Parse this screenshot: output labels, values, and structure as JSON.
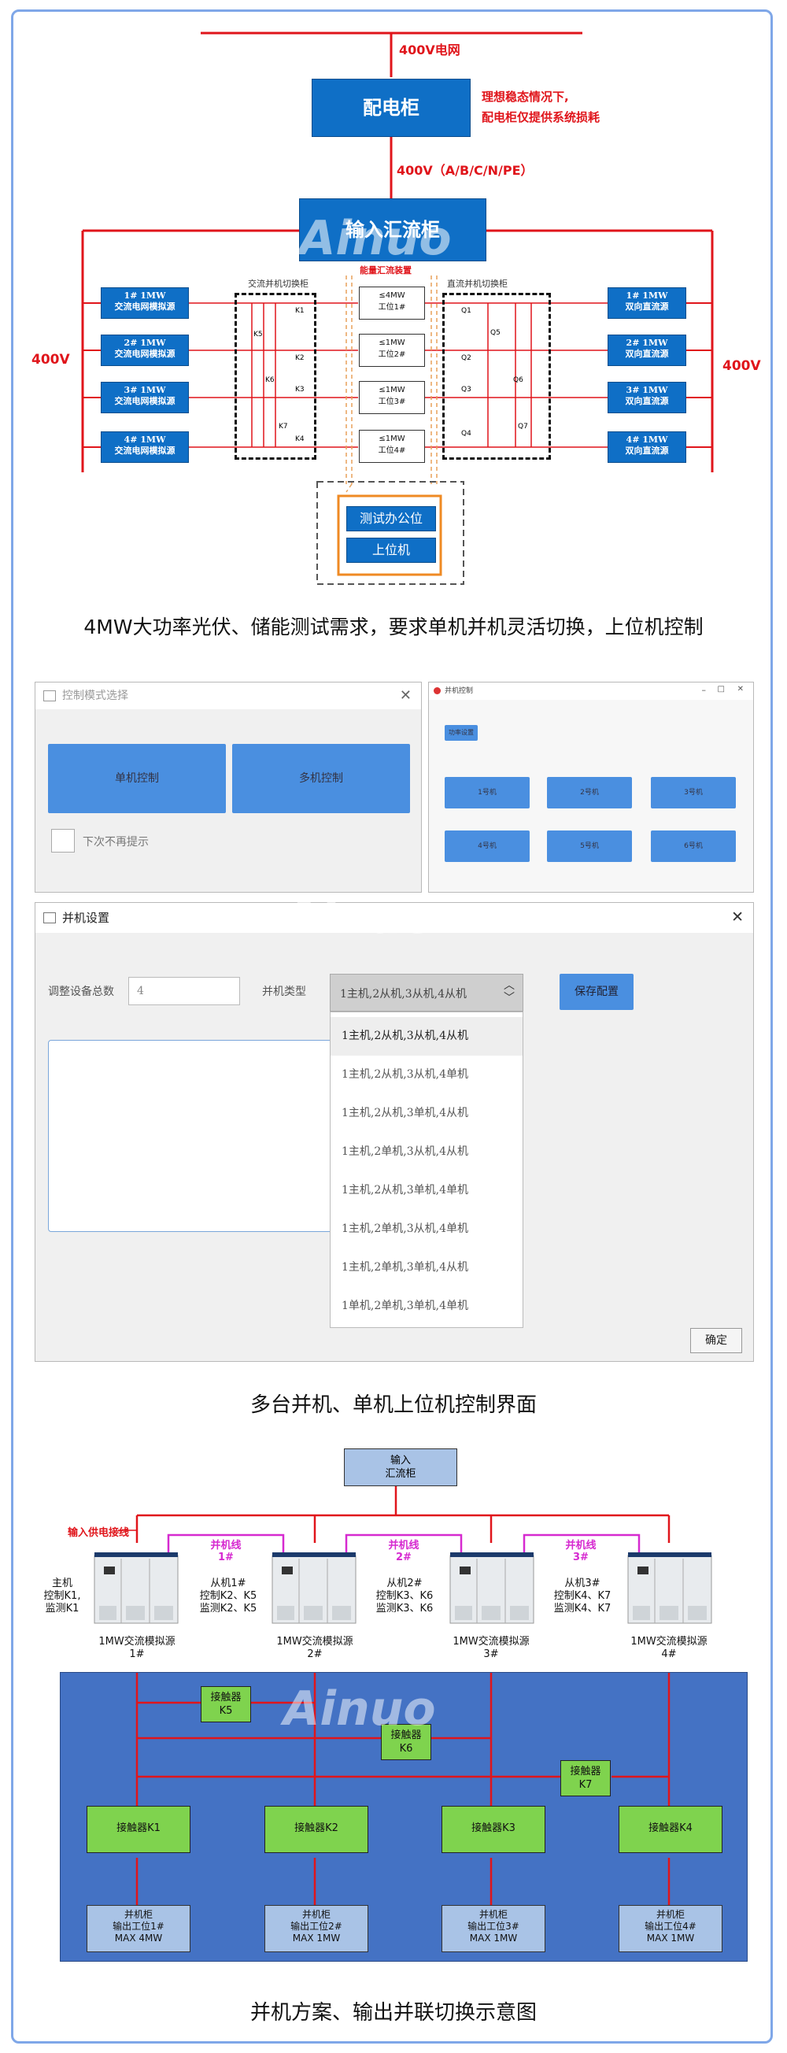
{
  "section1": {
    "grid_label": "400V电网",
    "dist_cabinet": "配电柜",
    "note_line1": "理想稳态情况下,",
    "note_line2": "配电柜仅提供系统损耗",
    "bus_label": "400V（A/B/C/N/PE）",
    "input_cabinet": "输入汇流柜",
    "ac_switch_label": "交流并机切换柜",
    "energy_label": "能量汇流装置",
    "dc_switch_label": "直流并机切换柜",
    "left_voltage": "400V",
    "right_voltage": "400V",
    "ac_sources": [
      {
        "l1": "1#    1MW",
        "l2": "交流电网模拟源"
      },
      {
        "l1": "2#    1MW",
        "l2": "交流电网模拟源"
      },
      {
        "l1": "3#    1MW",
        "l2": "交流电网模拟源"
      },
      {
        "l1": "4#    1MW",
        "l2": "交流电网模拟源"
      }
    ],
    "dc_sources": [
      {
        "l1": "1#    1MW",
        "l2": "双向直流源"
      },
      {
        "l1": "2#    1MW",
        "l2": "双向直流源"
      },
      {
        "l1": "3#    1MW",
        "l2": "双向直流源"
      },
      {
        "l1": "4#    1MW",
        "l2": "双向直流源"
      }
    ],
    "stations": [
      {
        "l1": "≤4MW",
        "l2": "工位1#"
      },
      {
        "l1": "≤1MW",
        "l2": "工位2#"
      },
      {
        "l1": "≤1MW",
        "l2": "工位3#"
      },
      {
        "l1": "≤1MW",
        "l2": "工位4#"
      }
    ],
    "ac_switches": [
      "K1",
      "K2",
      "K3",
      "K4",
      "K5",
      "K6",
      "K7"
    ],
    "dc_switches": [
      "Q1",
      "Q2",
      "Q3",
      "Q4",
      "Q5",
      "Q6",
      "Q7"
    ],
    "test_office": "测试办公位",
    "host_pc": "上位机",
    "caption": "4MW大功率光伏、储能测试需求，要求单机并机灵活切换，上位机控制"
  },
  "watermark": "Ainuo",
  "section2": {
    "mode_window": {
      "title": "控制模式选择",
      "single_btn": "单机控制",
      "multi_btn": "多机控制",
      "checkbox_label": "下次不再提示"
    },
    "unit_window": {
      "title": "并机控制",
      "small_btn": "功率设置",
      "units_row1": [
        "1号机",
        "2号机",
        "3号机"
      ],
      "units_row2": [
        "4号机",
        "5号机",
        "6号机"
      ]
    },
    "parallel_window": {
      "title": "并机设置",
      "count_label": "调整设备总数",
      "count_value": "4",
      "type_label": "并机类型",
      "type_value": "1主机,2从机,3从机,4从机",
      "save_btn": "保存配置",
      "ok_btn": "确定",
      "options": [
        "1主机,2从机,3从机,4从机",
        "1主机,2从机,3从机,4单机",
        "1主机,2从机,3单机,4从机",
        "1主机,2单机,3从机,4从机",
        "1主机,2从机,3单机,4单机",
        "1主机,2单机,3从机,4单机",
        "1主机,2单机,3单机,4从机",
        "1单机,2单机,3单机,4单机"
      ]
    },
    "caption": "多台并机、单机上位机控制界面"
  },
  "section3": {
    "input_cabinet_l1": "输入",
    "input_cabinet_l2": "汇流柜",
    "input_line": "输入供电接线",
    "parallel_lines": [
      {
        "l1": "并机线",
        "l2": "1#"
      },
      {
        "l1": "并机线",
        "l2": "2#"
      },
      {
        "l1": "并机线",
        "l2": "3#"
      }
    ],
    "roles": [
      {
        "l1": "主机",
        "l2": "控制K1,",
        "l3": "监测K1"
      },
      {
        "l1": "从机1#",
        "l2": "控制K2、K5",
        "l3": "监测K2、K5"
      },
      {
        "l1": "从机2#",
        "l2": "控制K3、K6",
        "l3": "监测K3、K6"
      },
      {
        "l1": "从机3#",
        "l2": "控制K4、K7",
        "l3": "监测K4、K7"
      }
    ],
    "sources": [
      {
        "l1": "1MW交流模拟源",
        "l2": "1#"
      },
      {
        "l1": "1MW交流模拟源",
        "l2": "2#"
      },
      {
        "l1": "1MW交流模拟源",
        "l2": "3#"
      },
      {
        "l1": "1MW交流模拟源",
        "l2": "4#"
      }
    ],
    "contactor_k5": {
      "l1": "接触器",
      "l2": "K5"
    },
    "contactor_k6": {
      "l1": "接触器",
      "l2": "K6"
    },
    "contactor_k7": {
      "l1": "接触器",
      "l2": "K7"
    },
    "contactors_main": [
      "接触器K1",
      "接触器K2",
      "接触器K3",
      "接触器K4"
    ],
    "outputs": [
      {
        "l1": "并机柜",
        "l2": "输出工位1#",
        "l3": "MAX 4MW"
      },
      {
        "l1": "并机柜",
        "l2": "输出工位2#",
        "l3": "MAX 1MW"
      },
      {
        "l1": "并机柜",
        "l2": "输出工位3#",
        "l3": "MAX 1MW"
      },
      {
        "l1": "并机柜",
        "l2": "输出工位4#",
        "l3": "MAX 1MW"
      }
    ],
    "caption": "并机方案、输出并联切换示意图"
  },
  "colors": {
    "line_red": "#e0151b",
    "box_blue": "#0f6fc6",
    "panel_blue": "#4472c4",
    "green": "#7fd34e",
    "magenta": "#d62ad0"
  }
}
